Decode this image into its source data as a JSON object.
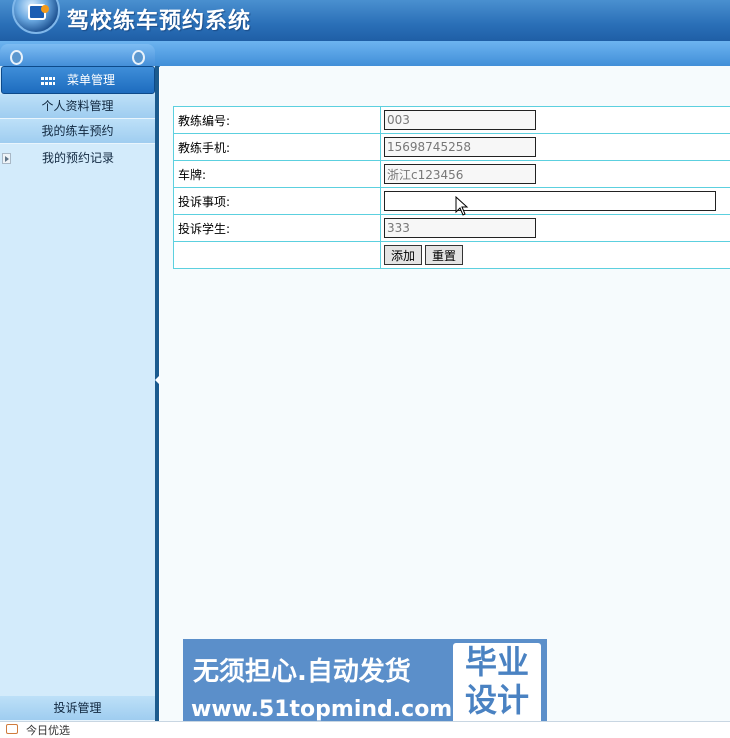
{
  "header": {
    "title": "驾校练车预约系统"
  },
  "sidebar": {
    "menu_title": "菜单管理",
    "items": [
      {
        "label": "个人资料管理"
      },
      {
        "label": "我的练车预约"
      }
    ],
    "sub_items": [
      {
        "label": "我的预约记录"
      }
    ],
    "bottom_item": "投诉管理"
  },
  "form": {
    "rows": [
      {
        "label": "教练编号:",
        "value": "003"
      },
      {
        "label": "教练手机:",
        "value": "15698745258"
      },
      {
        "label": "车牌:",
        "value": "浙江c123456"
      },
      {
        "label": "投诉事项:",
        "value": ""
      },
      {
        "label": "投诉学生:",
        "value": "333"
      }
    ],
    "buttons": {
      "add": "添加",
      "reset": "重置"
    }
  },
  "banner": {
    "line1": "无须担心.自动发货",
    "line2": "www.51topmind.com",
    "badge_line1": "毕业",
    "badge_line2": "设计"
  },
  "footer": {
    "text": "今日优选"
  }
}
